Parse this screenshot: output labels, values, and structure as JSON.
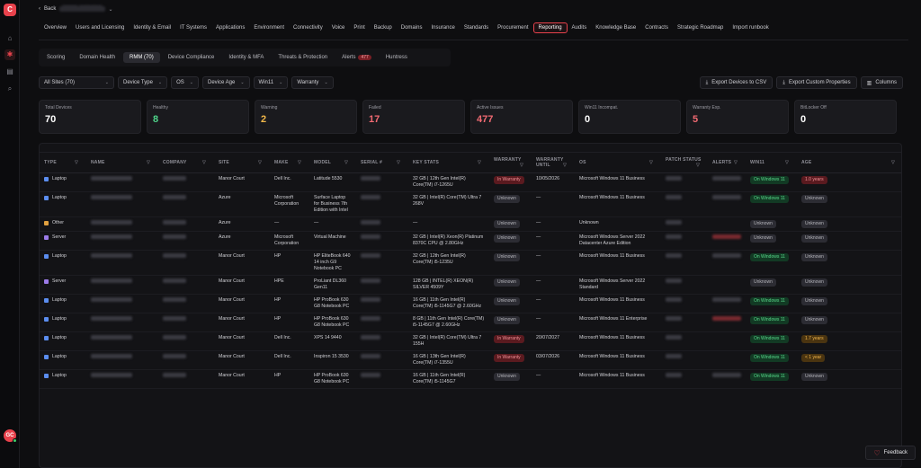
{
  "nav": {
    "back_label": "Back",
    "breadcrumb": "████ ██████",
    "tabs": [
      "Overview",
      "Users and Licensing",
      "Identity & Email",
      "IT Systems",
      "Applications",
      "Environment",
      "Connectivity",
      "Voice",
      "Print",
      "Backup",
      "Domains",
      "Insurance",
      "Standards",
      "Procurement",
      "Reporting",
      "Audits",
      "Knowledge Base",
      "Contracts",
      "Strategic Roadmap",
      "Import runbook"
    ],
    "active_tab": "Reporting"
  },
  "subtabs": {
    "items": [
      "Scoring",
      "Domain Health",
      "RMM (70)",
      "Device Compliance",
      "Identity & MFA",
      "Threats & Protection",
      "Alerts",
      "Huntress"
    ],
    "active": "RMM (70)",
    "alerts_badge": "477"
  },
  "filters": {
    "site": "All Sites (70)",
    "device_type": "Device Type",
    "os": "OS",
    "device_age": "Device Age",
    "win11": "Win11",
    "warranty": "Warranty"
  },
  "actions": {
    "export_csv": "Export Devices to CSV",
    "export_custom": "Export Custom Properties",
    "columns": "Columns"
  },
  "stats": [
    {
      "label": "Total Devices",
      "value": "70",
      "color": "#ffffff"
    },
    {
      "label": "Healthy",
      "value": "8",
      "color": "#4fd48a"
    },
    {
      "label": "Warning",
      "value": "2",
      "color": "#f2b84a"
    },
    {
      "label": "Failed",
      "value": "17",
      "color": "#f26a72"
    },
    {
      "label": "Active Issues",
      "value": "477",
      "color": "#f26a72"
    },
    {
      "label": "Win11 Incompat.",
      "value": "0",
      "color": "#ffffff"
    },
    {
      "label": "Warranty Exp.",
      "value": "5",
      "color": "#f26a72"
    },
    {
      "label": "BitLocker Off",
      "value": "0",
      "color": "#ffffff"
    }
  ],
  "table": {
    "headers": [
      "TYPE",
      "NAME",
      "COMPANY",
      "SITE",
      "MAKE",
      "MODEL",
      "SERIAL #",
      "KEY STATS",
      "WARRANTY",
      "WARRANTY UNTIL",
      "OS",
      "PATCH STATUS",
      "ALERTS",
      "WIN11",
      "AGE"
    ],
    "rows": [
      {
        "type": "Laptop",
        "type_color": "#5b8def",
        "site": "Manor Court",
        "make": "Dell Inc.",
        "model": "Latitude 5530",
        "stats": "32 GB | 12th Gen Intel(R) Core(TM) i7-1265U",
        "warranty": "In Warranty",
        "warranty_style": "red",
        "until": "10/05/2026",
        "os": "Microsoft Windows 11 Business",
        "win11": "On Windows 11",
        "win11_style": "green",
        "age": "1.0 years",
        "age_style": "red",
        "alert": true
      },
      {
        "type": "Laptop",
        "type_color": "#5b8def",
        "site": "Azure",
        "make": "Microsoft Corporation",
        "model": "Surface Laptop for Business 7th Edition with Intel",
        "stats": "32 GB | Intel(R) Core(TM) Ultra 7 268V",
        "warranty": "Unknown",
        "warranty_style": "gray",
        "until": "—",
        "os": "Microsoft Windows 11 Business",
        "win11": "On Windows 11",
        "win11_style": "green",
        "age": "Unknown",
        "age_style": "gray",
        "alert": true
      },
      {
        "type": "Other",
        "type_color": "#e0a040",
        "site": "Azure",
        "make": "—",
        "model": "—",
        "stats": "—",
        "warranty": "Unknown",
        "warranty_style": "gray",
        "until": "—",
        "os": "Unknown",
        "win11": "Unknown",
        "win11_style": "gray",
        "age": "Unknown",
        "age_style": "gray",
        "alert": false
      },
      {
        "type": "Server",
        "type_color": "#9b7be8",
        "site": "Azure",
        "make": "Microsoft Corporation",
        "model": "Virtual Machine",
        "stats": "32 GB | Intel(R) Xeon(R) Platinum 8370C CPU @ 2.80GHz",
        "warranty": "Unknown",
        "warranty_style": "gray",
        "until": "—",
        "os": "Microsoft Windows Server 2022 Datacenter Azure Edition",
        "win11": "Unknown",
        "win11_style": "gray",
        "age": "Unknown",
        "age_style": "gray",
        "alert": true
      },
      {
        "type": "Laptop",
        "type_color": "#5b8def",
        "site": "Manor Court",
        "make": "HP",
        "model": "HP EliteBook 640 14 inch G9 Notebook PC",
        "stats": "32 GB | 12th Gen Intel(R) Core(TM) i5-1235U",
        "warranty": "Unknown",
        "warranty_style": "gray",
        "until": "—",
        "os": "Microsoft Windows 11 Business",
        "win11": "On Windows 11",
        "win11_style": "green",
        "age": "Unknown",
        "age_style": "gray",
        "alert": true
      },
      {
        "type": "Server",
        "type_color": "#9b7be8",
        "site": "Manor Court",
        "make": "HPE",
        "model": "ProLiant DL360 Gen11",
        "stats": "128 GB | INTEL(R) XEON(R) SILVER 4509Y",
        "warranty": "Unknown",
        "warranty_style": "gray",
        "until": "—",
        "os": "Microsoft Windows Server 2022 Standard",
        "win11": "Unknown",
        "win11_style": "gray",
        "age": "Unknown",
        "age_style": "gray",
        "alert": false
      },
      {
        "type": "Laptop",
        "type_color": "#5b8def",
        "site": "Manor Court",
        "make": "HP",
        "model": "HP ProBook 630 G8 Notebook PC",
        "stats": "16 GB | 11th Gen Intel(R) Core(TM) i5-1145G7 @ 2.60GHz",
        "warranty": "Unknown",
        "warranty_style": "gray",
        "until": "—",
        "os": "Microsoft Windows 11 Business",
        "win11": "On Windows 11",
        "win11_style": "green",
        "age": "Unknown",
        "age_style": "gray",
        "alert": true
      },
      {
        "type": "Laptop",
        "type_color": "#5b8def",
        "site": "Manor Court",
        "make": "HP",
        "model": "HP ProBook 630 G8 Notebook PC",
        "stats": "8 GB | 11th Gen Intel(R) Core(TM) i5-1145G7 @ 2.60GHz",
        "warranty": "Unknown",
        "warranty_style": "gray",
        "until": "—",
        "os": "Microsoft Windows 11 Enterprise",
        "win11": "On Windows 11",
        "win11_style": "green",
        "age": "Unknown",
        "age_style": "gray",
        "alert": true
      },
      {
        "type": "Laptop",
        "type_color": "#5b8def",
        "site": "Manor Court",
        "make": "Dell Inc.",
        "model": "XPS 14 9440",
        "stats": "32 GB | Intel(R) Core(TM) Ultra 7 155H",
        "warranty": "In Warranty",
        "warranty_style": "red",
        "until": "20/07/2027",
        "os": "Microsoft Windows 11 Business",
        "win11": "On Windows 11",
        "win11_style": "green",
        "age": "1.7 years",
        "age_style": "amber",
        "alert": false
      },
      {
        "type": "Laptop",
        "type_color": "#5b8def",
        "site": "Manor Court",
        "make": "Dell Inc.",
        "model": "Inspiron 15 3530",
        "stats": "16 GB | 13th Gen Intel(R) Core(TM) i7-1355U",
        "warranty": "In Warranty",
        "warranty_style": "red",
        "until": "03/07/2026",
        "os": "Microsoft Windows 11 Business",
        "win11": "On Windows 11",
        "win11_style": "green",
        "age": "< 1 year",
        "age_style": "amber",
        "alert": false
      },
      {
        "type": "Laptop",
        "type_color": "#5b8def",
        "site": "Manor Court",
        "make": "HP",
        "model": "HP ProBook 630 G8 Notebook PC",
        "stats": "16 GB | 11th Gen Intel(R) Core(TM) i5-1145G7",
        "warranty": "Unknown",
        "warranty_style": "gray",
        "until": "—",
        "os": "Microsoft Windows 11 Business",
        "win11": "On Windows 11",
        "win11_style": "green",
        "age": "Unknown",
        "age_style": "gray",
        "alert": true
      }
    ]
  },
  "feedback_label": "Feedback"
}
